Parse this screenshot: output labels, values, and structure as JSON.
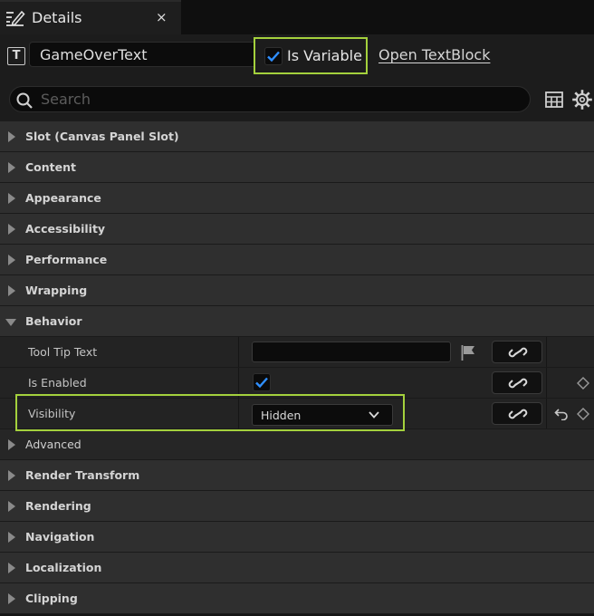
{
  "tab": {
    "title": "Details",
    "close": "×"
  },
  "header": {
    "widget_name": "GameOverText",
    "is_variable_label": "Is Variable",
    "is_variable_checked": true,
    "open_link": "Open TextBlock",
    "search_placeholder": "Search"
  },
  "categories_top": [
    "Slot (Canvas Panel Slot)",
    "Content",
    "Appearance",
    "Accessibility",
    "Performance",
    "Wrapping"
  ],
  "behavior": {
    "label": "Behavior",
    "tooltip_label": "Tool Tip Text",
    "is_enabled_label": "Is Enabled",
    "is_enabled_checked": true,
    "visibility_label": "Visibility",
    "visibility_value": "Hidden",
    "advanced_label": "Advanced"
  },
  "categories_bottom": [
    "Render Transform",
    "Rendering",
    "Navigation",
    "Localization",
    "Clipping"
  ],
  "colors": {
    "accent_highlight": "#a4d13d",
    "checkbox_blue": "#2f8fff"
  }
}
